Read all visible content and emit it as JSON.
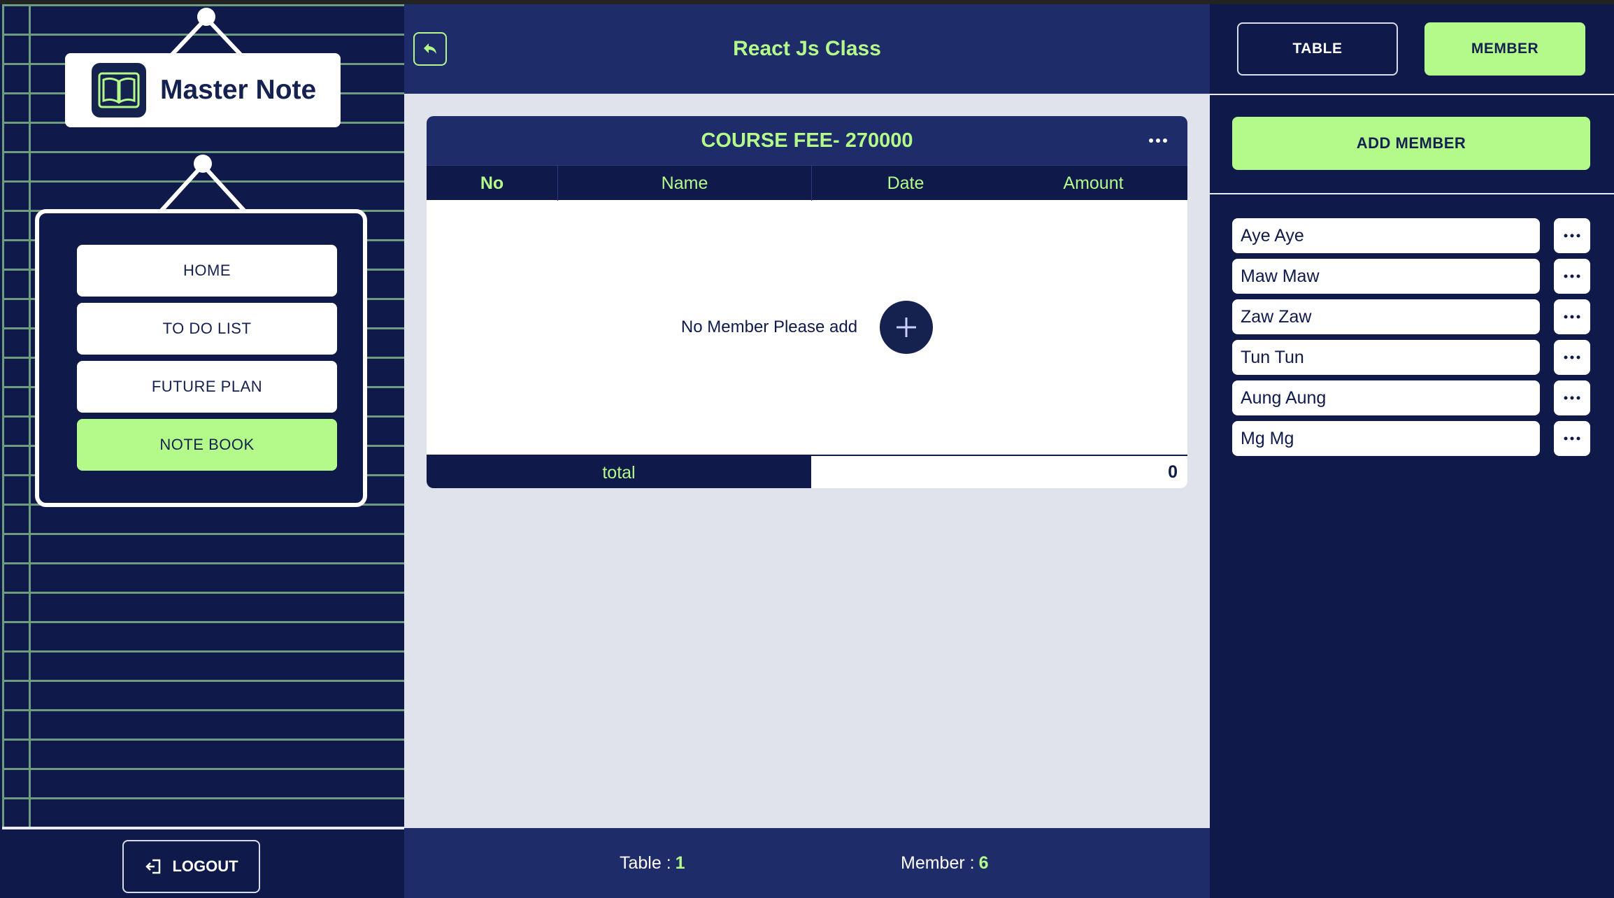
{
  "app": {
    "name": "Master Note"
  },
  "sidebar": {
    "menu": [
      {
        "label": "HOME"
      },
      {
        "label": "TO DO LIST"
      },
      {
        "label": "FUTURE PLAN"
      },
      {
        "label": "NOTE BOOK",
        "active": true
      }
    ],
    "logout_label": "LOGOUT"
  },
  "header": {
    "title": "React Js Class"
  },
  "card": {
    "title": "COURSE FEE- 270000",
    "columns": [
      "No",
      "Name",
      "Date",
      "Amount"
    ],
    "empty_text": "No Member Please add",
    "total_label": "total",
    "total_value": "0"
  },
  "footer": {
    "table_label": "Table :",
    "table_count": "1",
    "member_label": "Member :",
    "member_count": "6"
  },
  "right_panel": {
    "tabs": [
      {
        "label": "TABLE",
        "active": false
      },
      {
        "label": "MEMBER",
        "active": true
      }
    ],
    "add_member_label": "ADD MEMBER",
    "members": [
      "Aye Aye",
      "Maw Maw",
      "Zaw Zaw",
      "Tun Tun",
      "Aung Aung",
      "Mg Mg"
    ]
  },
  "colors": {
    "navy": "#0f1a4b",
    "header_navy": "#1e2c69",
    "accent_green": "#b4fa8a",
    "content_bg": "#e0e2ec",
    "brick_mortar": "#6e9c7e"
  },
  "icons": [
    "book-icon",
    "back-arrow-icon",
    "more-dots-icon",
    "plus-icon",
    "logout-icon"
  ]
}
